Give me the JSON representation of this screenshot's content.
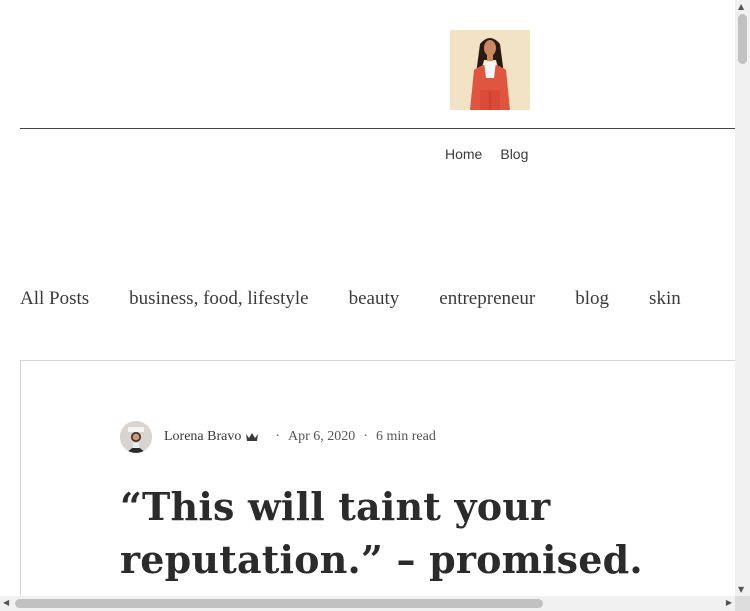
{
  "header": {
    "logo_icon": "woman-in-red-suit-illustration-icon"
  },
  "nav": {
    "items": [
      {
        "label": "Home"
      },
      {
        "label": "Blog"
      }
    ]
  },
  "categories": {
    "items": [
      {
        "label": "All Posts"
      },
      {
        "label": "business, food, lifestyle"
      },
      {
        "label": "beauty"
      },
      {
        "label": "entrepreneur"
      },
      {
        "label": "blog"
      },
      {
        "label": "skin"
      }
    ]
  },
  "post": {
    "author": "Lorena Bravo",
    "author_badge_icon": "admin-crown-icon",
    "separator": "·",
    "date": "Apr 6, 2020",
    "read_time": "6 min read",
    "title": "“This will taint your reputation.” – promised."
  },
  "colors": {
    "logo_background": "#f2e3c4",
    "suit_red": "#e0553f",
    "text": "#2b2b2b"
  }
}
